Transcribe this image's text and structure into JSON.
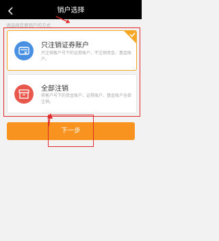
{
  "navbar": {
    "title": "销户选择"
  },
  "hint": "请选择您要销户的方式",
  "options": [
    {
      "title": "只注销证券账户",
      "desc": "只注销客户号下的证券账户，不注销资金、基金账户。",
      "selected": true
    },
    {
      "title": "全部注销",
      "desc": "将客户号下的资金账户、证券账户、基金账户全部注销。",
      "selected": false
    }
  ],
  "next_button": "下一步",
  "colors": {
    "accent": "#f7931e",
    "selected_border": "#f5a623",
    "annotation": "#e02a2a"
  }
}
